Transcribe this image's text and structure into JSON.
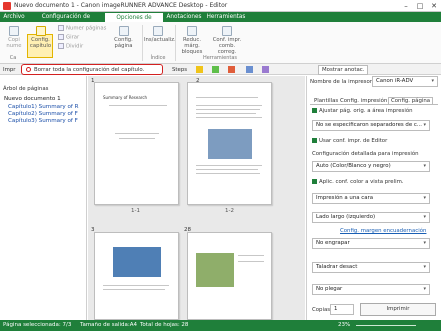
{
  "window": {
    "title": "Nuevo documento 1 - Canon imageRUNNER ADVANCE Desktop - Editor",
    "min": "–",
    "max": "□",
    "close": "✕"
  },
  "tabs": [
    "Archivo",
    "Configuración de impresión",
    "Opciones de impresión",
    "Anotaciones",
    "Herramientas"
  ],
  "ribbon": {
    "copies": "Copi nume",
    "configure_chapter": "Config. capítulo",
    "numbering_pages": "Numer páginas",
    "rotate": "Girar",
    "divide": "Dividir",
    "configure_page": "Config. página",
    "insert_update": "Ins/actualiz.",
    "index_group": "Índice",
    "reduce_margin": "Reduc. márg. bloques",
    "config_combined": "Conf. impr. comb. correg.",
    "tools_group": "Herramientas",
    "cap_group": "Ca"
  },
  "toolbar2": {
    "print_label": "Impr",
    "redbox_text": "Borrar toda la configuración del capítulo.",
    "stepper": "Steps",
    "show_annot": "Mostrar anotac."
  },
  "tree": {
    "header": "Árbol de páginas",
    "root": "Nuevo documento 1",
    "items": [
      "Capítulo1) Summary of R",
      "Capítulo2) Summary of F",
      "Capítulo3) Summary of F"
    ]
  },
  "pages": [
    {
      "label": "1-1",
      "num": "1",
      "title": "Summary of Research"
    },
    {
      "label": "1-2",
      "num": "2",
      "title": "Introduction"
    },
    {
      "label": "",
      "num": "3",
      "title": ""
    },
    {
      "label": "",
      "num": "28",
      "title": ""
    }
  ],
  "right": {
    "printer_label": "Nombre de la impresora:",
    "printer_value": "Canon iR-ADV",
    "tabs": [
      "Plantillas",
      "Config. impresión",
      "Config. página"
    ],
    "adjust": "Ajustar pág. orig. a área impresión",
    "separator": "No se especificaron separadores de c...",
    "user_conf": "Usar conf. impr. de Editor",
    "detailed_label": "Configuración detallada para impresión",
    "color": "Auto (Color/Blanco y negro)",
    "apply_prev": "Aplic. conf. color a vista prelim.",
    "side": "Impresión a una cara",
    "long_edge": "Lado largo (izquierdo)",
    "margin_link": "Config. margen encuadernación",
    "no_staple": "No engrapar",
    "punch": "Taladrar desact",
    "no_fold": "No plegar",
    "copies_label": "Copias",
    "copies_value": "1",
    "print_button": "Imprimir"
  },
  "status": {
    "selected": "Página seleccionada: 7/3",
    "size": "Tamaño de salida:A4",
    "total": "Total de hojas: 28",
    "zoom": "23%"
  }
}
